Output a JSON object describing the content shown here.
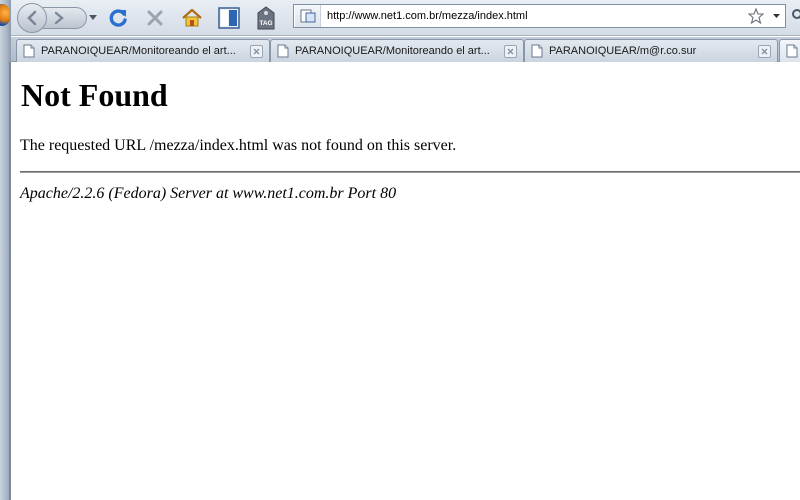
{
  "browser": {
    "url": "http://www.net1.com.br/mezza/index.html",
    "toolbar_icons": [
      "back-icon",
      "forward-icon",
      "history-dropdown-icon",
      "reload-icon",
      "stop-icon",
      "home-icon",
      "bookmark-icon",
      "tag-icon",
      "site-identity-icon",
      "star-icon",
      "dropdown-arrow-icon",
      "search-icon"
    ],
    "tag_button_label": "TAG"
  },
  "tabs": [
    {
      "label": "PARANOIQUEAR/Monitoreando el art...",
      "icon": "page-icon"
    },
    {
      "label": "PARANOIQUEAR/Monitoreando el art...",
      "icon": "page-icon"
    },
    {
      "label": "PARANOIQUEAR/m@r.co.sur",
      "icon": "page-icon"
    },
    {
      "label": "",
      "icon": "page-icon"
    }
  ],
  "page": {
    "title": "Not Found",
    "message": "The requested URL /mezza/index.html was not found on this server.",
    "address": "Apache/2.2.6 (Fedora) Server at www.net1.com.br Port 80"
  },
  "colors": {
    "chrome_light": "#e9eef4",
    "chrome_dark": "#aebccc",
    "reload_blue": "#2a6fd1",
    "page_background": "#ffffff",
    "text": "#000000"
  }
}
